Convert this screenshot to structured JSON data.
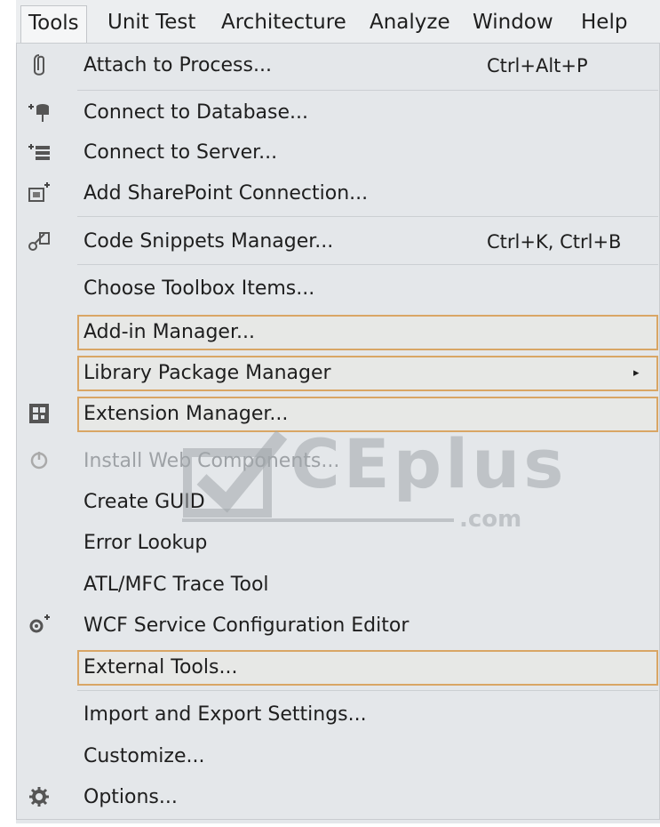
{
  "menubar": {
    "items": [
      "Tools",
      "Unit Test",
      "Architecture",
      "Analyze",
      "Window",
      "Help"
    ],
    "active": "Tools"
  },
  "menu": {
    "items": [
      {
        "label": "Attach to Process...",
        "shortcut": "Ctrl+Alt+P",
        "icon": "attach-process-icon"
      },
      {
        "label": "Connect to Database...",
        "icon": "connect-database-icon"
      },
      {
        "label": "Connect to Server...",
        "icon": "connect-server-icon"
      },
      {
        "label": "Add SharePoint Connection...",
        "icon": "sharepoint-connection-icon"
      },
      {
        "label": "Code Snippets Manager...",
        "shortcut": "Ctrl+K, Ctrl+B",
        "icon": "code-snippets-icon"
      },
      {
        "label": "Choose Toolbox Items..."
      },
      {
        "label": "Add-in Manager...",
        "highlighted": true
      },
      {
        "label": "Library Package Manager",
        "submenu": true,
        "highlighted": true
      },
      {
        "label": "Extension Manager...",
        "highlighted": true,
        "icon": "extension-manager-icon"
      },
      {
        "label": "Install Web Components...",
        "disabled": true,
        "icon": "install-web-components-icon"
      },
      {
        "label": "Create GUID"
      },
      {
        "label": "Error Lookup"
      },
      {
        "label": "ATL/MFC Trace Tool"
      },
      {
        "label": "WCF Service Configuration Editor",
        "icon": "wcf-config-icon"
      },
      {
        "label": "External Tools...",
        "highlighted": true
      },
      {
        "label": "Import and Export Settings..."
      },
      {
        "label": "Customize..."
      },
      {
        "label": "Options...",
        "icon": "options-gear-icon"
      }
    ]
  },
  "submenu_arrow": "▸",
  "watermark": {
    "text": "CEplus",
    "sub": ".com"
  },
  "colors": {
    "menu_bg": "#e4e7ea",
    "highlight_border": "#d9a665",
    "disabled_text": "#9ea2a6",
    "text": "#1e1e1e"
  }
}
